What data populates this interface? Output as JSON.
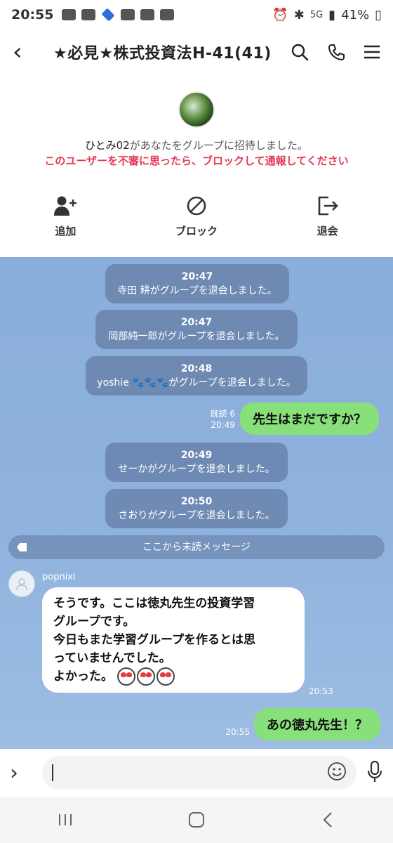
{
  "status_bar": {
    "time": "20:55",
    "network": "5G",
    "battery": "41%"
  },
  "header": {
    "title": "★必見★株式投資法H-41(41)"
  },
  "invite": {
    "inviter": "ひとみ02",
    "text": "があなたをグループに招待しました。",
    "warning": "このユーザーを不審に思ったら、ブロックして通報してください",
    "actions": [
      {
        "label": "追加",
        "icon": "add-user-icon"
      },
      {
        "label": "ブロック",
        "icon": "block-icon"
      },
      {
        "label": "退会",
        "icon": "leave-icon"
      }
    ]
  },
  "messages": [
    {
      "type": "system",
      "time": "20:47",
      "text": "寺田 耕がグループを退会しました。"
    },
    {
      "type": "system",
      "time": "20:47",
      "text": "岡部純一郎がグループを退会しました。"
    },
    {
      "type": "system",
      "time": "20:48",
      "text": "yoshie 🐾🐾🐾がグループを退会しました。"
    },
    {
      "type": "outgoing",
      "read": "既読 6",
      "time": "20:49",
      "text": "先生はまだですか？"
    },
    {
      "type": "system",
      "time": "20:49",
      "text": "せーかがグループを退会しました。"
    },
    {
      "type": "system",
      "time": "20:50",
      "text": "さおりがグループを退会しました。"
    },
    {
      "type": "incoming",
      "sender": "popnixi",
      "time": "20:53",
      "text": "そうです。ここは徳丸先生の投資学習\nグループです。\n今日もまた学習グループを作るとは思\nっていませんでした。\nよかった。"
    },
    {
      "type": "outgoing",
      "time": "20:55",
      "text": "あの徳丸先生！？"
    }
  ],
  "unread_divider": "ここから未読メッセージ",
  "input": {
    "placeholder": ""
  }
}
